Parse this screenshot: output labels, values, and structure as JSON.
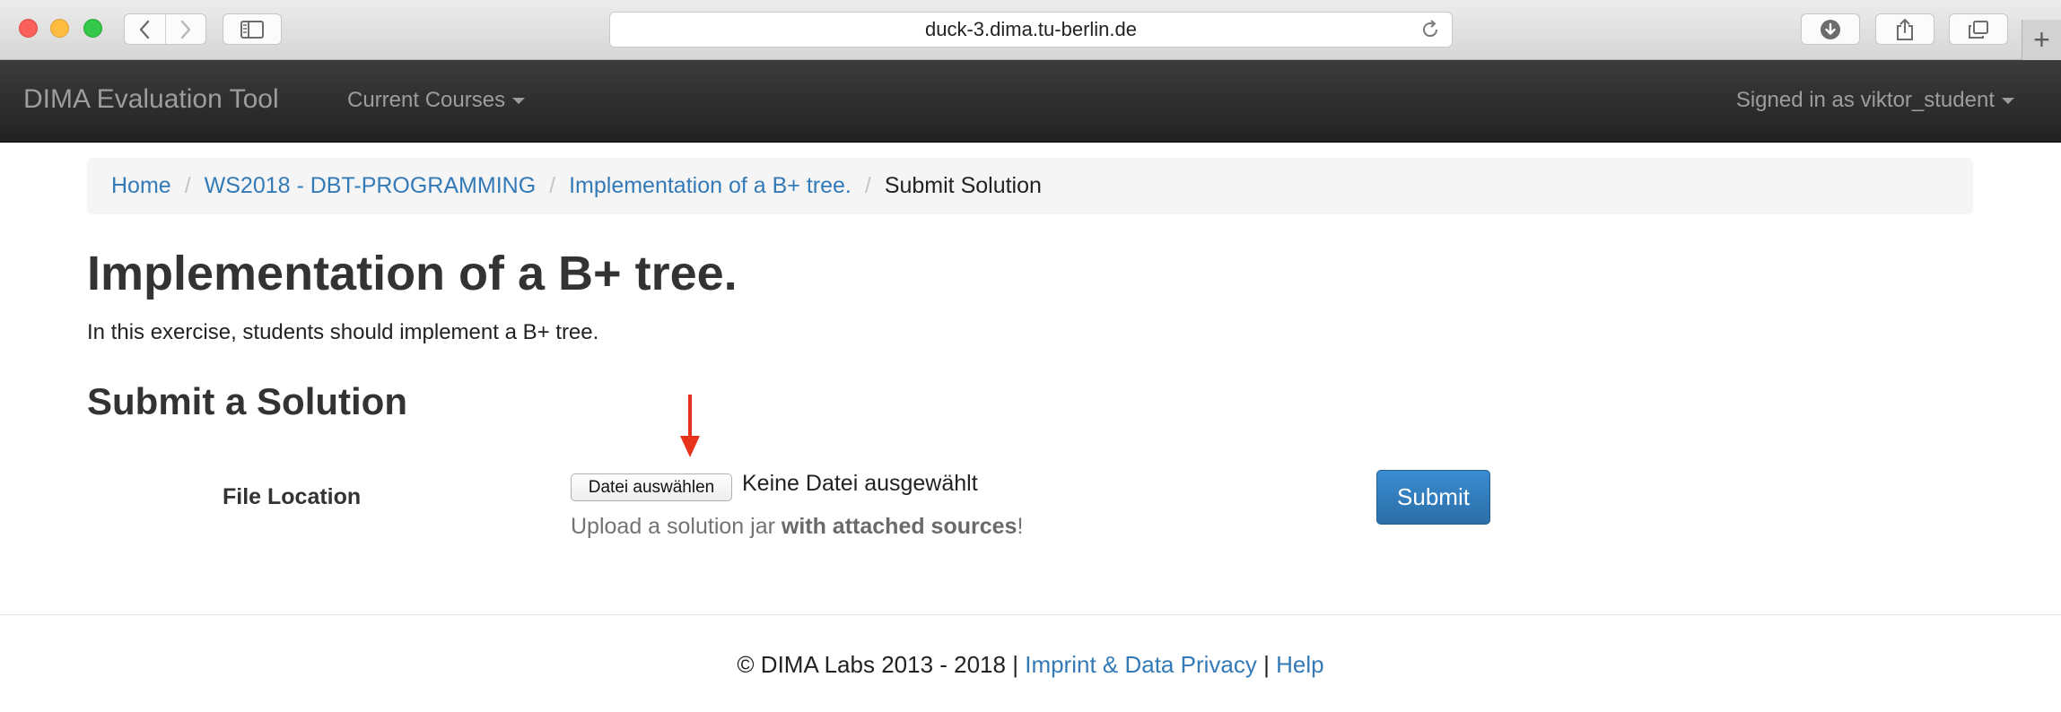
{
  "browser": {
    "url": "duck-3.dima.tu-berlin.de",
    "new_tab_label": "+"
  },
  "navbar": {
    "brand": "DIMA Evaluation Tool",
    "courses_menu": "Current Courses",
    "user_menu": "Signed in as viktor_student"
  },
  "breadcrumb": {
    "items": [
      "Home",
      "WS2018 - DBT-PROGRAMMING",
      "Implementation of a B+ tree."
    ],
    "active": "Submit Solution",
    "separator": "/"
  },
  "page": {
    "title": "Implementation of a B+ tree.",
    "description": "In this exercise, students should implement a B+ tree.",
    "section_title": "Submit a Solution"
  },
  "form": {
    "file_label": "File Location",
    "file_button": "Datei auswählen",
    "file_status": "Keine Datei ausgewählt",
    "help_prefix": "Upload a solution jar ",
    "help_bold": "with attached sources",
    "help_suffix": "!",
    "submit_label": "Submit"
  },
  "footer": {
    "copyright": "© DIMA Labs 2013 - 2018",
    "sep": "|",
    "imprint_link": "Imprint & Data Privacy",
    "help_link": "Help"
  },
  "colors": {
    "link": "#337ab7",
    "navbar": "#222222",
    "primary_button": "#337ab7",
    "annotation_arrow": "#e8331c"
  }
}
